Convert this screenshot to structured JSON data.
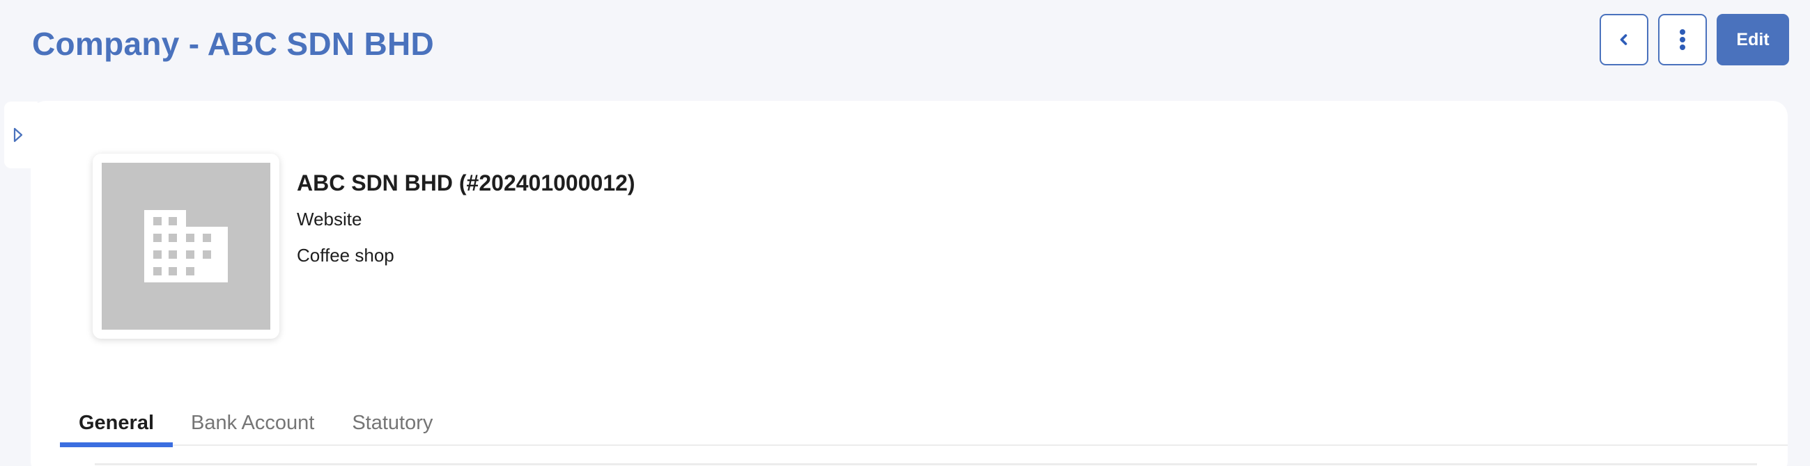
{
  "header": {
    "title": "Company - ABC SDN BHD",
    "actions": {
      "back_icon": "chevron-left-icon",
      "more_icon": "more-vertical-icon",
      "edit_label": "Edit"
    }
  },
  "sidebar": {
    "toggle_icon": "triangle-right-icon"
  },
  "company": {
    "name": "ABC SDN BHD (#202401000012)",
    "website": "Website",
    "description": "Coffee shop",
    "logo_icon": "building-icon"
  },
  "tabs": [
    {
      "label": "General",
      "active": true
    },
    {
      "label": "Bank Account",
      "active": false
    },
    {
      "label": "Statutory",
      "active": false
    }
  ],
  "colors": {
    "accent": "#4a72bd",
    "tab_indicator": "#3b6ee0",
    "background": "#f5f6fa",
    "logo_placeholder": "#c4c4c4"
  }
}
